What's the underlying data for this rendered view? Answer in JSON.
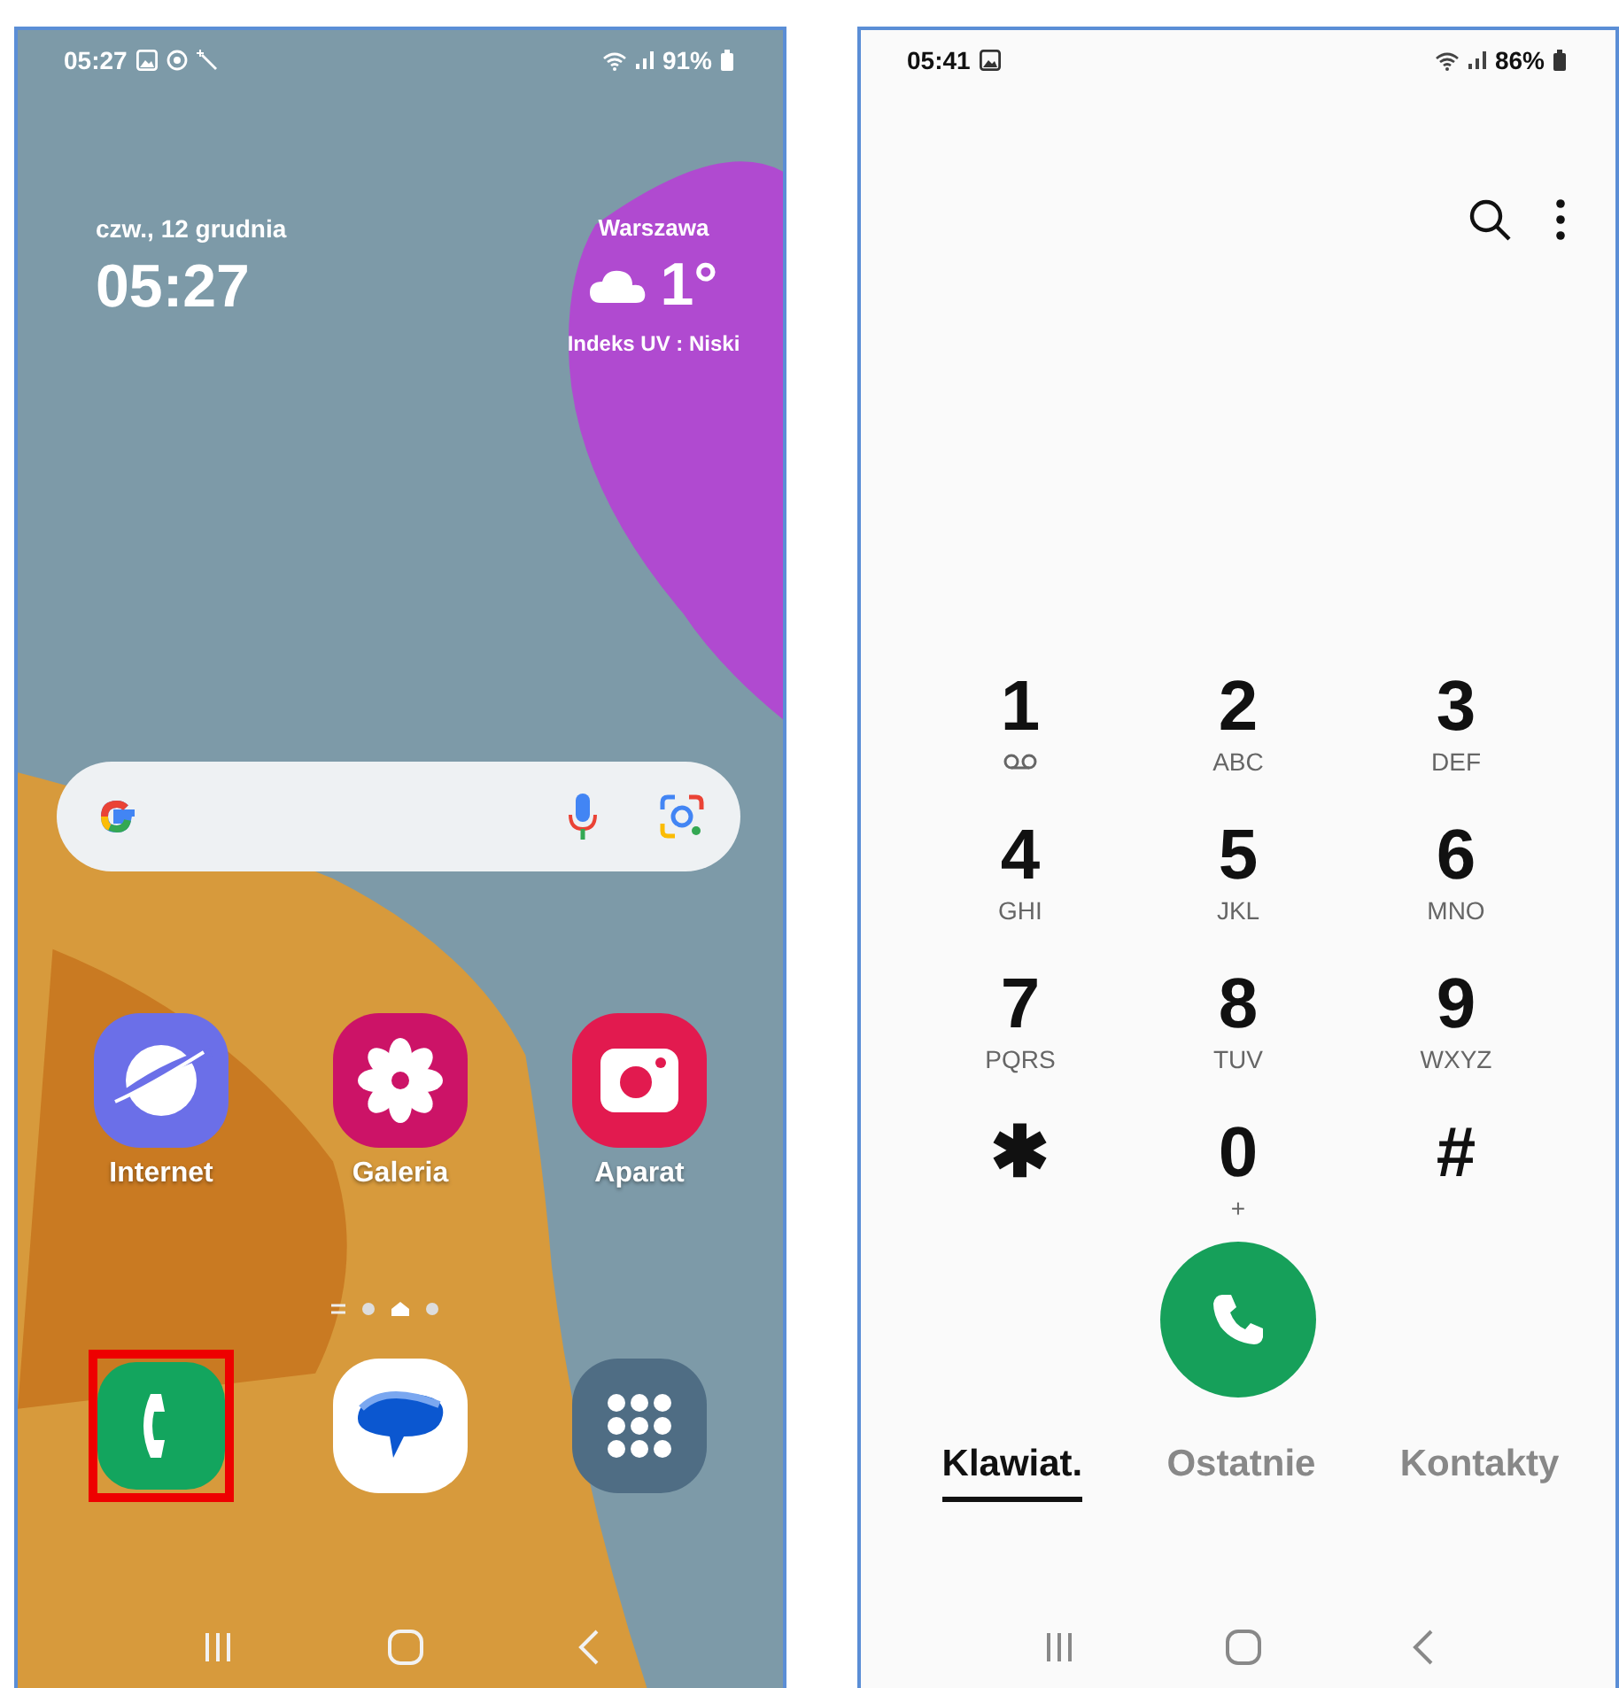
{
  "left_phone": {
    "status_bar": {
      "time": "05:27",
      "battery": "91%"
    },
    "date": "czw., 12 grudnia",
    "clock": "05:27",
    "weather": {
      "city": "Warszawa",
      "temperature": "1°",
      "uv": "Indeks UV : Niski"
    },
    "apps": [
      {
        "kind": "internet",
        "label": "Internet"
      },
      {
        "kind": "gallery",
        "label": "Galeria"
      },
      {
        "kind": "camera",
        "label": "Aparat"
      }
    ],
    "dock": [
      {
        "kind": "phone",
        "highlighted": true
      },
      {
        "kind": "messages",
        "highlighted": false
      },
      {
        "kind": "apps",
        "highlighted": false
      }
    ]
  },
  "right_phone": {
    "status_bar": {
      "time": "05:41",
      "battery": "86%"
    },
    "keys": [
      {
        "digit": "1",
        "kind": "voicemail"
      },
      {
        "digit": "2",
        "kind": "letters",
        "letters": "ABC"
      },
      {
        "digit": "3",
        "kind": "letters",
        "letters": "DEF"
      },
      {
        "digit": "4",
        "kind": "letters",
        "letters": "GHI"
      },
      {
        "digit": "5",
        "kind": "letters",
        "letters": "JKL"
      },
      {
        "digit": "6",
        "kind": "letters",
        "letters": "MNO"
      },
      {
        "digit": "7",
        "kind": "letters",
        "letters": "PQRS"
      },
      {
        "digit": "8",
        "kind": "letters",
        "letters": "TUV"
      },
      {
        "digit": "9",
        "kind": "letters",
        "letters": "WXYZ"
      },
      {
        "digit": "✱",
        "kind": "plain"
      },
      {
        "digit": "0",
        "kind": "letters",
        "letters": "+"
      },
      {
        "digit": "#",
        "kind": "plain"
      }
    ],
    "tabs": [
      {
        "label": "Klawiat.",
        "selected": true
      },
      {
        "label": "Ostatnie",
        "selected": false
      },
      {
        "label": "Kontakty",
        "selected": false
      }
    ]
  }
}
